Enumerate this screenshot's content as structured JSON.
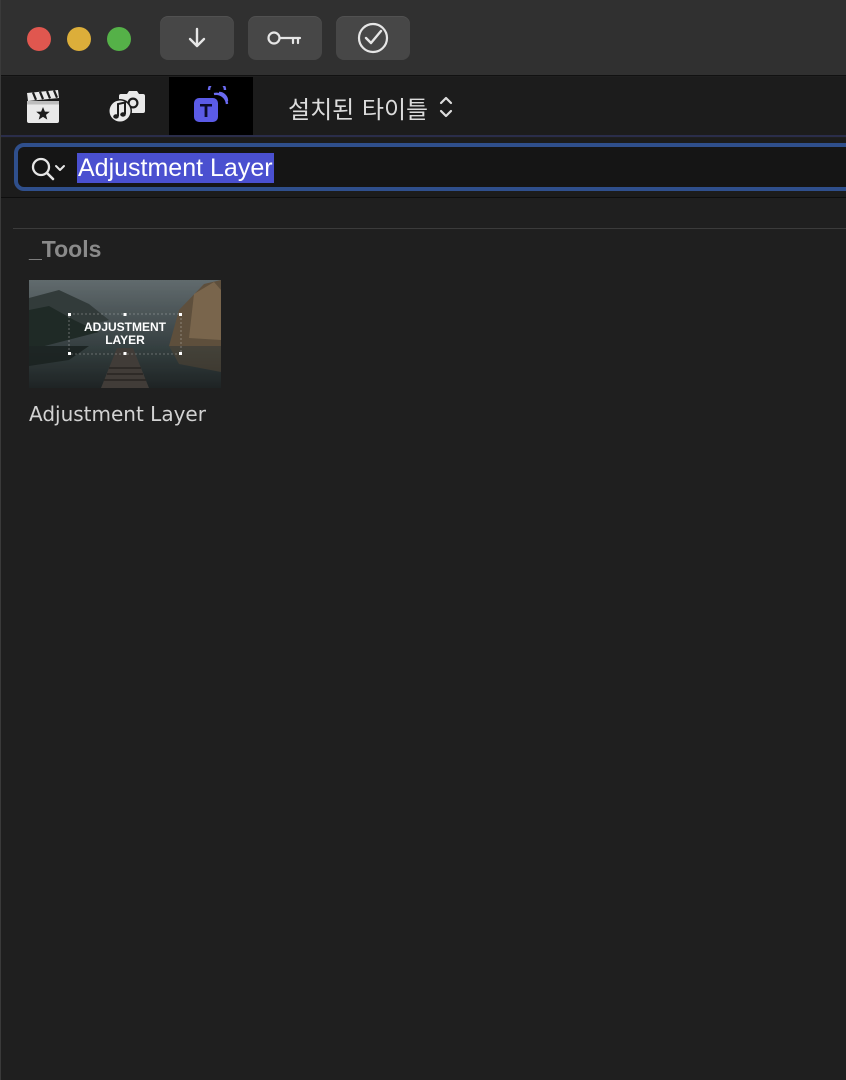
{
  "toolbar": {
    "import_button": "import-arrow",
    "keywords_button": "key",
    "background_tasks_button": "checkmark-circle"
  },
  "browser": {
    "library_selector_label": "설치된 타이틀",
    "active_mode": "titles-and-generators"
  },
  "search": {
    "value": "Adjustment Layer"
  },
  "section": {
    "title": "_Tools"
  },
  "items": [
    {
      "label": "Adjustment Layer",
      "thumb_text_line1": "ADJUSTMENT",
      "thumb_text_line2": "LAYER"
    }
  ],
  "colors": {
    "close": "#e0574f",
    "minimize": "#dcae3a",
    "zoom": "#55b148",
    "selection": "#4a50d0",
    "search_focus_ring": "#2f4f8c",
    "active_mode_accent": "#5b5be6"
  }
}
